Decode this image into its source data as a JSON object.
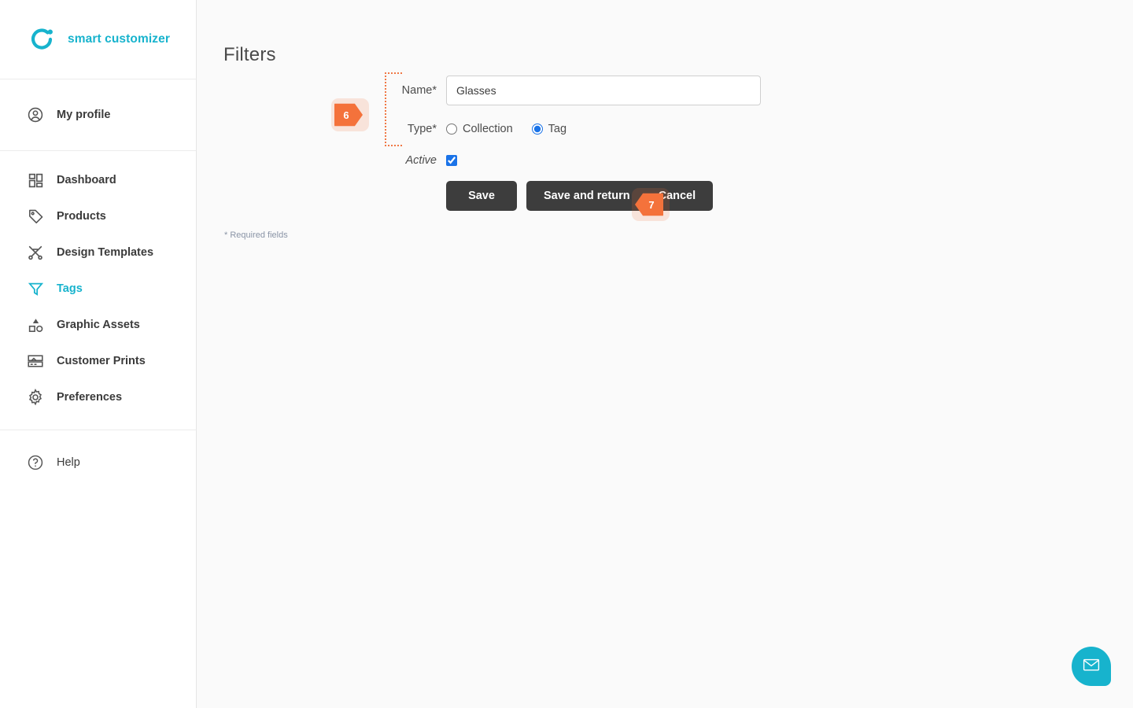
{
  "brand": {
    "name": "smart customizer",
    "logo_icon": "circle-dot-logo",
    "color": "#17b3cd"
  },
  "sidebar": {
    "groups": [
      {
        "items": [
          {
            "label": "My profile",
            "icon": "user-circle-icon",
            "active": false
          }
        ]
      },
      {
        "items": [
          {
            "label": "Dashboard",
            "icon": "dashboard-grid-icon",
            "active": false
          },
          {
            "label": "Products",
            "icon": "tag-icon",
            "active": false
          },
          {
            "label": "Design Templates",
            "icon": "design-templates-icon",
            "active": false
          },
          {
            "label": "Tags",
            "icon": "filter-funnel-icon",
            "active": true
          },
          {
            "label": "Graphic Assets",
            "icon": "shapes-icon",
            "active": false
          },
          {
            "label": "Customer Prints",
            "icon": "printer-panels-icon",
            "active": false
          },
          {
            "label": "Preferences",
            "icon": "gear-icon",
            "active": false
          }
        ]
      },
      {
        "items": [
          {
            "label": "Help",
            "icon": "question-circle-icon",
            "active": false
          }
        ]
      }
    ]
  },
  "main": {
    "page_title": "Filters",
    "required_note": "* Required fields",
    "form": {
      "name_label": "Name*",
      "name_value": "Glasses",
      "name_placeholder": "",
      "type_label": "Type*",
      "type_options": [
        {
          "label": "Collection",
          "selected": false
        },
        {
          "label": "Tag",
          "selected": true
        }
      ],
      "active_label": "Active",
      "active_checked": true,
      "buttons": {
        "save": "Save",
        "save_and_return": "Save and return",
        "cancel": "Cancel"
      }
    },
    "annotations": [
      {
        "number": "6",
        "direction": "right"
      },
      {
        "number": "7",
        "direction": "left"
      }
    ],
    "chat": {
      "icon": "envelope-icon",
      "color": "#17b3cd"
    }
  },
  "colors": {
    "accent": "#17b3cd",
    "annotation": "#f4723b",
    "button": "#3d3d3d",
    "radio_selected": "#1a73e8",
    "background": "#fafafa"
  }
}
